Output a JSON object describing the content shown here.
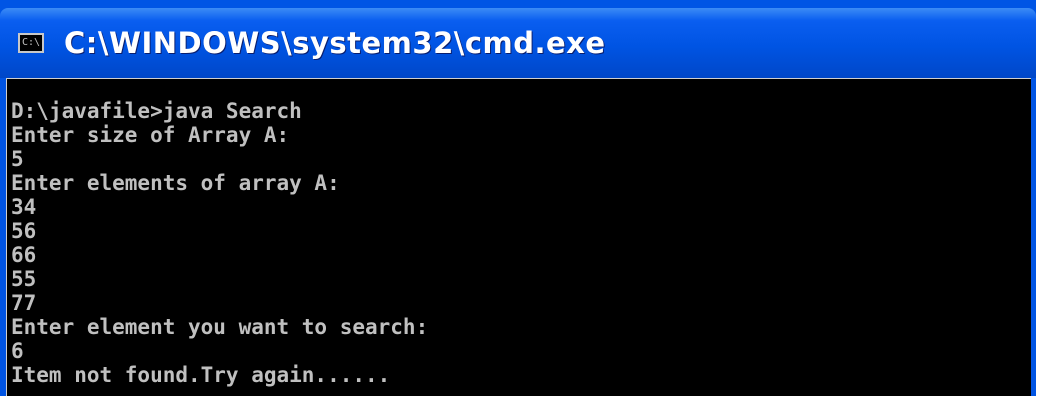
{
  "window": {
    "title": "C:\\WINDOWS\\system32\\cmd.exe",
    "icon": "cmd-icon",
    "icon_glyph": "C:\\"
  },
  "console": {
    "lines": [
      "D:\\javafile>java Search",
      "Enter size of Array A:",
      "5",
      "Enter elements of array A:",
      "34",
      "56",
      "66",
      "55",
      "77",
      "Enter element you want to search:",
      "6",
      "Item not found.Try again......"
    ]
  },
  "colors": {
    "titlebar": "#0054e3",
    "console_background": "#000000",
    "console_text": "#c0c0c0",
    "title_text": "#ffffff"
  }
}
